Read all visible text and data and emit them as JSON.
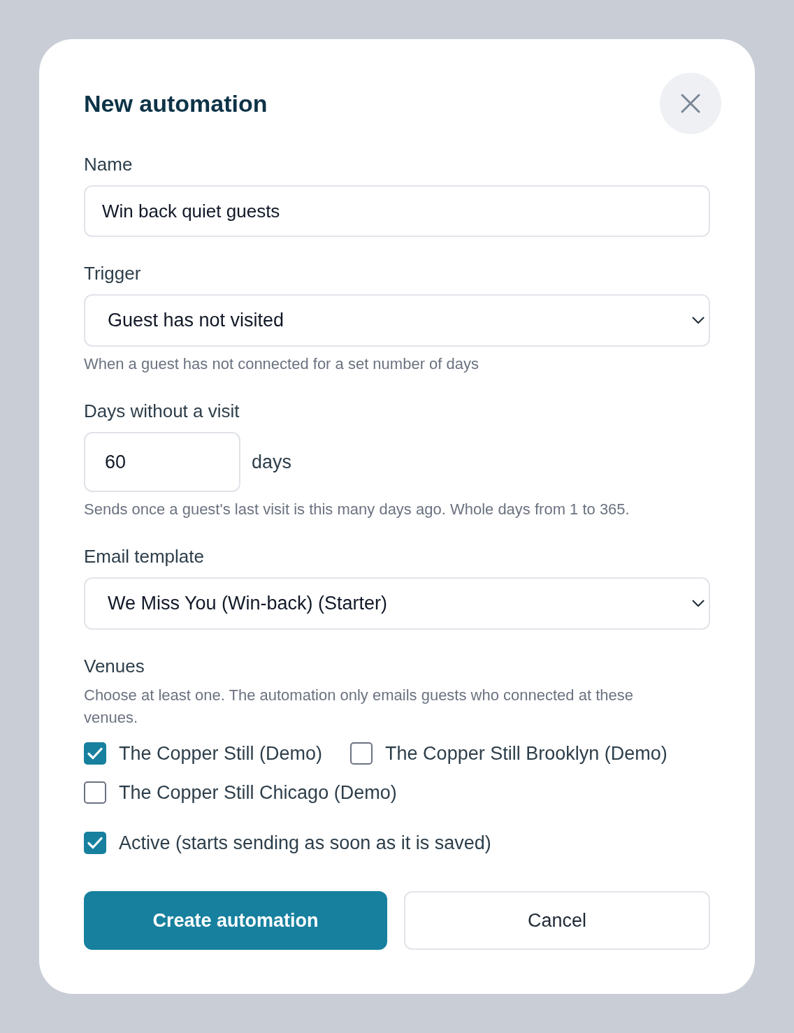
{
  "dialog": {
    "title": "New automation"
  },
  "name_field": {
    "label": "Name",
    "value": "Win back quiet guests"
  },
  "trigger": {
    "label": "Trigger",
    "value": "Guest has not visited",
    "hint": "When a guest has not connected for a set number of days"
  },
  "days": {
    "label": "Days without a visit",
    "value": "60",
    "unit": "days",
    "hint": "Sends once a guest's last visit is this many days ago. Whole days from 1 to 365."
  },
  "email_template": {
    "label": "Email template",
    "value": "We Miss You (Win-back) (Starter)"
  },
  "venues": {
    "label": "Venues",
    "hint": "Choose at least one. The automation only emails guests who connected at these venues.",
    "options": [
      {
        "label": "The Copper Still (Demo)",
        "checked": true
      },
      {
        "label": "The Copper Still Brooklyn (Demo)",
        "checked": false
      },
      {
        "label": "The Copper Still Chicago (Demo)",
        "checked": false
      }
    ]
  },
  "active": {
    "label": "Active (starts sending as soon as it is saved)",
    "checked": true
  },
  "buttons": [
    {
      "label": "Create automation",
      "kind": "primary"
    },
    {
      "label": "Cancel",
      "kind": "secondary"
    }
  ]
}
